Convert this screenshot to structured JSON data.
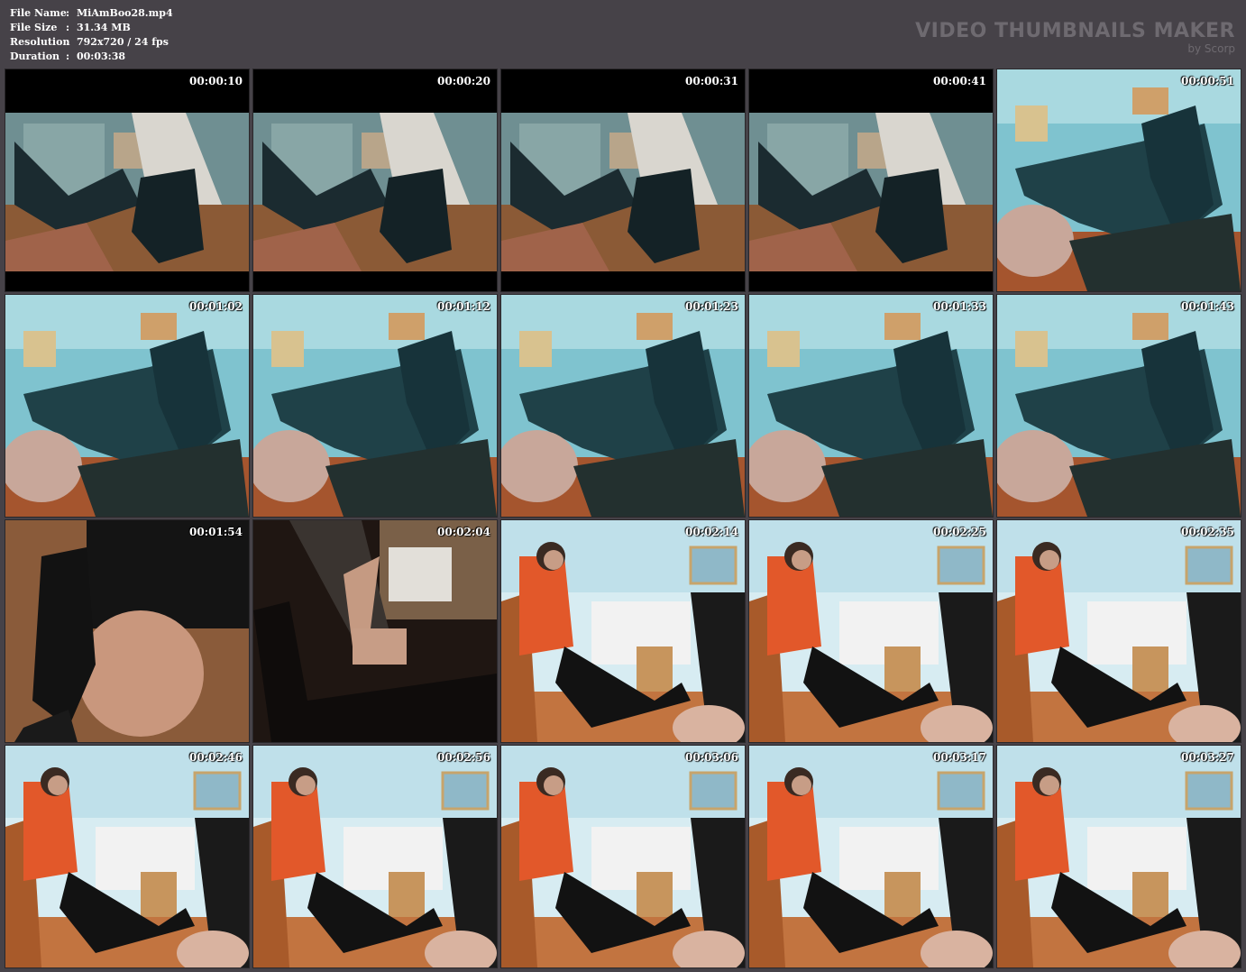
{
  "file_info": [
    {
      "label": "File Name",
      "value": "MiAmBoo28.mp4"
    },
    {
      "label": "File Size",
      "value": "31.34 MB"
    },
    {
      "label": "Resolution",
      "value": "792x720 / 24 fps"
    },
    {
      "label": "Duration",
      "value": "00:03:38"
    }
  ],
  "brand": {
    "title": "VIDEO THUMBNAILS MAKER",
    "subtitle": "by Scorp"
  },
  "thumbnails": [
    {
      "time": "00:00:10",
      "scene": "a"
    },
    {
      "time": "00:00:20",
      "scene": "a"
    },
    {
      "time": "00:00:31",
      "scene": "a"
    },
    {
      "time": "00:00:41",
      "scene": "a"
    },
    {
      "time": "00:00:51",
      "scene": "b"
    },
    {
      "time": "00:01:02",
      "scene": "b"
    },
    {
      "time": "00:01:12",
      "scene": "b"
    },
    {
      "time": "00:01:23",
      "scene": "b"
    },
    {
      "time": "00:01:33",
      "scene": "b"
    },
    {
      "time": "00:01:43",
      "scene": "b"
    },
    {
      "time": "00:01:54",
      "scene": "c"
    },
    {
      "time": "00:02:04",
      "scene": "d"
    },
    {
      "time": "00:02:14",
      "scene": "e"
    },
    {
      "time": "00:02:25",
      "scene": "e"
    },
    {
      "time": "00:02:35",
      "scene": "e"
    },
    {
      "time": "00:02:46",
      "scene": "e"
    },
    {
      "time": "00:02:56",
      "scene": "e"
    },
    {
      "time": "00:03:06",
      "scene": "e"
    },
    {
      "time": "00:03:17",
      "scene": "e"
    },
    {
      "time": "00:03:27",
      "scene": "e"
    }
  ]
}
